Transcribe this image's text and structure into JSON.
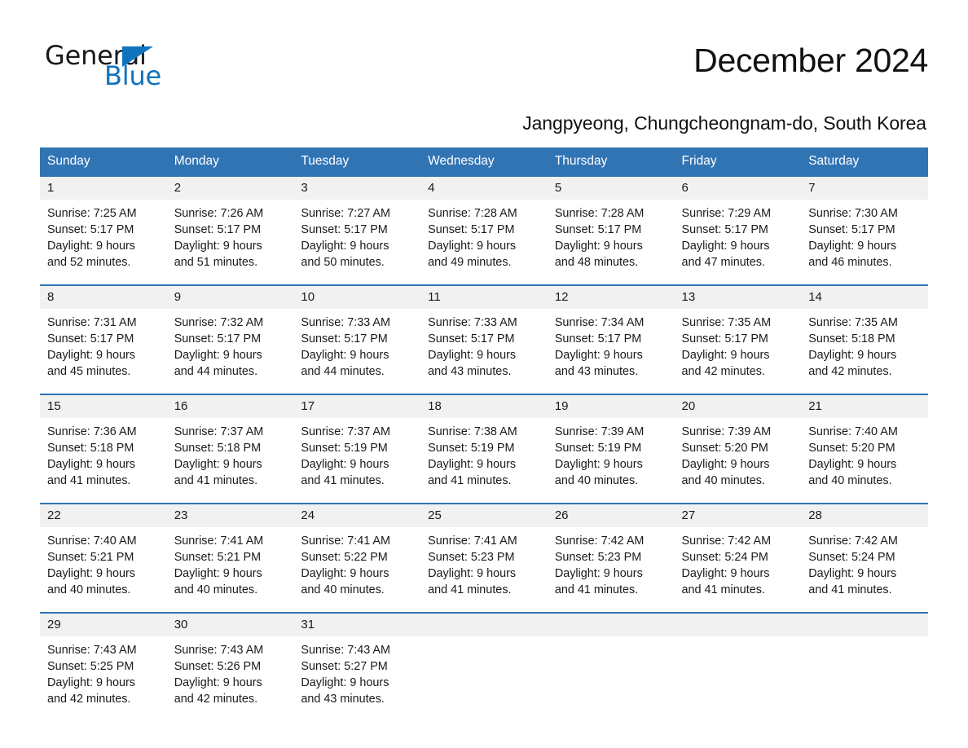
{
  "logo": {
    "word_one": "General",
    "word_two": "Blue",
    "triangle_color": "#1073bd",
    "icon": "triangle-icon"
  },
  "header": {
    "title": "December 2024",
    "subtitle": "Jangpyeong, Chungcheongnam-do, South Korea"
  },
  "theme": {
    "header_blue": "#3174b4",
    "row_divider_blue": "#3174b4",
    "daynum_background": "#f1f1f1",
    "text": "#1a1a1a"
  },
  "calendar": {
    "weekday_headers": [
      "Sunday",
      "Monday",
      "Tuesday",
      "Wednesday",
      "Thursday",
      "Friday",
      "Saturday"
    ],
    "weeks": [
      [
        {
          "day": "1",
          "sunrise": "Sunrise: 7:25 AM",
          "sunset": "Sunset: 5:17 PM",
          "daylight_line1": "Daylight: 9 hours",
          "daylight_line2": "and 52 minutes."
        },
        {
          "day": "2",
          "sunrise": "Sunrise: 7:26 AM",
          "sunset": "Sunset: 5:17 PM",
          "daylight_line1": "Daylight: 9 hours",
          "daylight_line2": "and 51 minutes."
        },
        {
          "day": "3",
          "sunrise": "Sunrise: 7:27 AM",
          "sunset": "Sunset: 5:17 PM",
          "daylight_line1": "Daylight: 9 hours",
          "daylight_line2": "and 50 minutes."
        },
        {
          "day": "4",
          "sunrise": "Sunrise: 7:28 AM",
          "sunset": "Sunset: 5:17 PM",
          "daylight_line1": "Daylight: 9 hours",
          "daylight_line2": "and 49 minutes."
        },
        {
          "day": "5",
          "sunrise": "Sunrise: 7:28 AM",
          "sunset": "Sunset: 5:17 PM",
          "daylight_line1": "Daylight: 9 hours",
          "daylight_line2": "and 48 minutes."
        },
        {
          "day": "6",
          "sunrise": "Sunrise: 7:29 AM",
          "sunset": "Sunset: 5:17 PM",
          "daylight_line1": "Daylight: 9 hours",
          "daylight_line2": "and 47 minutes."
        },
        {
          "day": "7",
          "sunrise": "Sunrise: 7:30 AM",
          "sunset": "Sunset: 5:17 PM",
          "daylight_line1": "Daylight: 9 hours",
          "daylight_line2": "and 46 minutes."
        }
      ],
      [
        {
          "day": "8",
          "sunrise": "Sunrise: 7:31 AM",
          "sunset": "Sunset: 5:17 PM",
          "daylight_line1": "Daylight: 9 hours",
          "daylight_line2": "and 45 minutes."
        },
        {
          "day": "9",
          "sunrise": "Sunrise: 7:32 AM",
          "sunset": "Sunset: 5:17 PM",
          "daylight_line1": "Daylight: 9 hours",
          "daylight_line2": "and 44 minutes."
        },
        {
          "day": "10",
          "sunrise": "Sunrise: 7:33 AM",
          "sunset": "Sunset: 5:17 PM",
          "daylight_line1": "Daylight: 9 hours",
          "daylight_line2": "and 44 minutes."
        },
        {
          "day": "11",
          "sunrise": "Sunrise: 7:33 AM",
          "sunset": "Sunset: 5:17 PM",
          "daylight_line1": "Daylight: 9 hours",
          "daylight_line2": "and 43 minutes."
        },
        {
          "day": "12",
          "sunrise": "Sunrise: 7:34 AM",
          "sunset": "Sunset: 5:17 PM",
          "daylight_line1": "Daylight: 9 hours",
          "daylight_line2": "and 43 minutes."
        },
        {
          "day": "13",
          "sunrise": "Sunrise: 7:35 AM",
          "sunset": "Sunset: 5:17 PM",
          "daylight_line1": "Daylight: 9 hours",
          "daylight_line2": "and 42 minutes."
        },
        {
          "day": "14",
          "sunrise": "Sunrise: 7:35 AM",
          "sunset": "Sunset: 5:18 PM",
          "daylight_line1": "Daylight: 9 hours",
          "daylight_line2": "and 42 minutes."
        }
      ],
      [
        {
          "day": "15",
          "sunrise": "Sunrise: 7:36 AM",
          "sunset": "Sunset: 5:18 PM",
          "daylight_line1": "Daylight: 9 hours",
          "daylight_line2": "and 41 minutes."
        },
        {
          "day": "16",
          "sunrise": "Sunrise: 7:37 AM",
          "sunset": "Sunset: 5:18 PM",
          "daylight_line1": "Daylight: 9 hours",
          "daylight_line2": "and 41 minutes."
        },
        {
          "day": "17",
          "sunrise": "Sunrise: 7:37 AM",
          "sunset": "Sunset: 5:19 PM",
          "daylight_line1": "Daylight: 9 hours",
          "daylight_line2": "and 41 minutes."
        },
        {
          "day": "18",
          "sunrise": "Sunrise: 7:38 AM",
          "sunset": "Sunset: 5:19 PM",
          "daylight_line1": "Daylight: 9 hours",
          "daylight_line2": "and 41 minutes."
        },
        {
          "day": "19",
          "sunrise": "Sunrise: 7:39 AM",
          "sunset": "Sunset: 5:19 PM",
          "daylight_line1": "Daylight: 9 hours",
          "daylight_line2": "and 40 minutes."
        },
        {
          "day": "20",
          "sunrise": "Sunrise: 7:39 AM",
          "sunset": "Sunset: 5:20 PM",
          "daylight_line1": "Daylight: 9 hours",
          "daylight_line2": "and 40 minutes."
        },
        {
          "day": "21",
          "sunrise": "Sunrise: 7:40 AM",
          "sunset": "Sunset: 5:20 PM",
          "daylight_line1": "Daylight: 9 hours",
          "daylight_line2": "and 40 minutes."
        }
      ],
      [
        {
          "day": "22",
          "sunrise": "Sunrise: 7:40 AM",
          "sunset": "Sunset: 5:21 PM",
          "daylight_line1": "Daylight: 9 hours",
          "daylight_line2": "and 40 minutes."
        },
        {
          "day": "23",
          "sunrise": "Sunrise: 7:41 AM",
          "sunset": "Sunset: 5:21 PM",
          "daylight_line1": "Daylight: 9 hours",
          "daylight_line2": "and 40 minutes."
        },
        {
          "day": "24",
          "sunrise": "Sunrise: 7:41 AM",
          "sunset": "Sunset: 5:22 PM",
          "daylight_line1": "Daylight: 9 hours",
          "daylight_line2": "and 40 minutes."
        },
        {
          "day": "25",
          "sunrise": "Sunrise: 7:41 AM",
          "sunset": "Sunset: 5:23 PM",
          "daylight_line1": "Daylight: 9 hours",
          "daylight_line2": "and 41 minutes."
        },
        {
          "day": "26",
          "sunrise": "Sunrise: 7:42 AM",
          "sunset": "Sunset: 5:23 PM",
          "daylight_line1": "Daylight: 9 hours",
          "daylight_line2": "and 41 minutes."
        },
        {
          "day": "27",
          "sunrise": "Sunrise: 7:42 AM",
          "sunset": "Sunset: 5:24 PM",
          "daylight_line1": "Daylight: 9 hours",
          "daylight_line2": "and 41 minutes."
        },
        {
          "day": "28",
          "sunrise": "Sunrise: 7:42 AM",
          "sunset": "Sunset: 5:24 PM",
          "daylight_line1": "Daylight: 9 hours",
          "daylight_line2": "and 41 minutes."
        }
      ],
      [
        {
          "day": "29",
          "sunrise": "Sunrise: 7:43 AM",
          "sunset": "Sunset: 5:25 PM",
          "daylight_line1": "Daylight: 9 hours",
          "daylight_line2": "and 42 minutes."
        },
        {
          "day": "30",
          "sunrise": "Sunrise: 7:43 AM",
          "sunset": "Sunset: 5:26 PM",
          "daylight_line1": "Daylight: 9 hours",
          "daylight_line2": "and 42 minutes."
        },
        {
          "day": "31",
          "sunrise": "Sunrise: 7:43 AM",
          "sunset": "Sunset: 5:27 PM",
          "daylight_line1": "Daylight: 9 hours",
          "daylight_line2": "and 43 minutes."
        },
        {
          "day": "",
          "sunrise": "",
          "sunset": "",
          "daylight_line1": "",
          "daylight_line2": ""
        },
        {
          "day": "",
          "sunrise": "",
          "sunset": "",
          "daylight_line1": "",
          "daylight_line2": ""
        },
        {
          "day": "",
          "sunrise": "",
          "sunset": "",
          "daylight_line1": "",
          "daylight_line2": ""
        },
        {
          "day": "",
          "sunrise": "",
          "sunset": "",
          "daylight_line1": "",
          "daylight_line2": ""
        }
      ]
    ]
  }
}
